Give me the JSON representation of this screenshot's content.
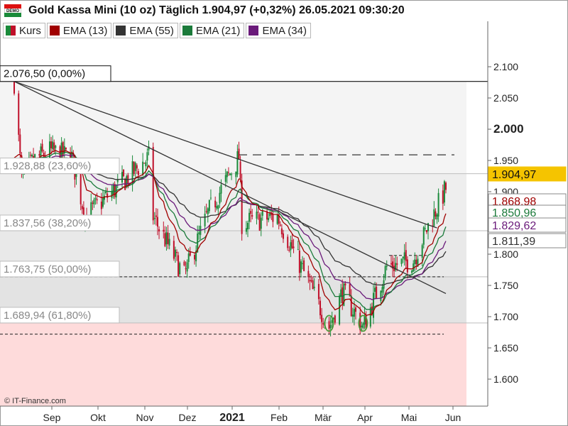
{
  "header": {
    "badge": "DEMO",
    "title": "Gold Kassa Mini (10 oz) Täglich 1.904,97 (+0,32%) 26.05.2021 09:30:20"
  },
  "legend": [
    {
      "label": "Kurs",
      "color": "#2e8b57"
    },
    {
      "label": "EMA (13)",
      "color": "#a00000"
    },
    {
      "label": "EMA (55)",
      "color": "#333333"
    },
    {
      "label": "EMA (21)",
      "color": "#1b7a3a"
    },
    {
      "label": "EMA (34)",
      "color": "#6a1a7a"
    }
  ],
  "copyright": "© IT-Finance.com",
  "chart_data": {
    "type": "candlestick",
    "title": "Gold Kassa Mini (10 oz) Täglich",
    "ylim": [
      1560,
      2150
    ],
    "y_ticks": [
      {
        "value": 2100,
        "label": "2.100"
      },
      {
        "value": 2050,
        "label": "2.050"
      },
      {
        "value": 2000,
        "label": "2.000"
      },
      {
        "value": 1950,
        "label": "1.950"
      },
      {
        "value": 1900,
        "label": "1.900"
      },
      {
        "value": 1850,
        "label": "1.850"
      },
      {
        "value": 1800,
        "label": "1.800"
      },
      {
        "value": 1750,
        "label": "1.750"
      },
      {
        "value": 1700,
        "label": "1.700"
      },
      {
        "value": 1650,
        "label": "1.650"
      },
      {
        "value": 1600,
        "label": "1.600"
      }
    ],
    "x_ticks": [
      "Sep",
      "Okt",
      "Nov",
      "Dez",
      "2021",
      "Feb",
      "Mär",
      "Apr",
      "Mai",
      "Jun"
    ],
    "fib_levels": [
      {
        "value": 2076.5,
        "label": "2.076,50 (0,00%)"
      },
      {
        "value": 1928.88,
        "label": "1.928,88 (23,60%)"
      },
      {
        "value": 1837.56,
        "label": "1.837,56 (38,20%)"
      },
      {
        "value": 1763.75,
        "label": "1.763,75 (50,00%)"
      },
      {
        "value": 1689.94,
        "label": "1.689,94 (61,80%)"
      }
    ],
    "price_tags": [
      {
        "value": 1904.97,
        "label": "1.904,97",
        "bg": "#f5c400",
        "fg": "#111111"
      },
      {
        "value": 1868.98,
        "label": "1.868,98",
        "bg": "#ffffff",
        "fg": "#a00000"
      },
      {
        "value": 1850.96,
        "label": "1.850,96",
        "bg": "#ffffff",
        "fg": "#1b7a3a"
      },
      {
        "value": 1829.62,
        "label": "1.829,62",
        "bg": "#ffffff",
        "fg": "#6a1a7a"
      },
      {
        "value": 1811.39,
        "label": "1.811,39",
        "bg": "#ffffff",
        "fg": "#333333"
      }
    ],
    "dashed_levels": [
      1959,
      1763.75,
      1672
    ],
    "trendlines": [
      {
        "from": [
          "2020-08-07",
          2076.5
        ],
        "to": [
          "2021-05-20",
          1842
        ]
      },
      {
        "from": [
          "2020-08-07",
          2076.5
        ],
        "to": [
          "2021-05-26",
          1737
        ]
      }
    ],
    "highlight_lows": [
      {
        "date": "2021-03-08",
        "value": 1678
      },
      {
        "date": "2021-03-31",
        "value": 1678
      }
    ],
    "monthly_path": [
      {
        "date": "2020-08-07",
        "close": 2076
      },
      {
        "date": "2020-08-12",
        "close": 1920
      },
      {
        "date": "2020-08-20",
        "close": 1950
      },
      {
        "date": "2020-08-31",
        "close": 1965
      },
      {
        "date": "2020-09-15",
        "close": 1955
      },
      {
        "date": "2020-09-24",
        "close": 1860
      },
      {
        "date": "2020-10-15",
        "close": 1905
      },
      {
        "date": "2020-11-06",
        "close": 1955
      },
      {
        "date": "2020-11-09",
        "close": 1860
      },
      {
        "date": "2020-11-30",
        "close": 1765
      },
      {
        "date": "2020-12-16",
        "close": 1865
      },
      {
        "date": "2021-01-06",
        "close": 1955
      },
      {
        "date": "2021-01-08",
        "close": 1850
      },
      {
        "date": "2021-02-01",
        "close": 1860
      },
      {
        "date": "2021-02-18",
        "close": 1775
      },
      {
        "date": "2021-03-08",
        "close": 1683
      },
      {
        "date": "2021-03-17",
        "close": 1740
      },
      {
        "date": "2021-03-31",
        "close": 1683
      },
      {
        "date": "2021-04-16",
        "close": 1780
      },
      {
        "date": "2021-05-04",
        "close": 1790
      },
      {
        "date": "2021-05-14",
        "close": 1845
      },
      {
        "date": "2021-05-26",
        "close": 1905
      }
    ]
  }
}
